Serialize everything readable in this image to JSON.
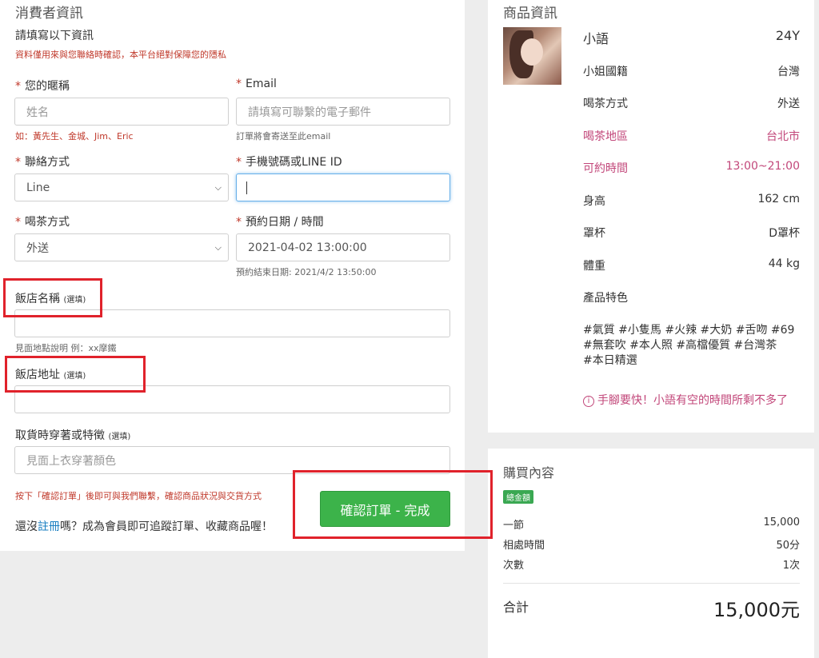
{
  "consumer": {
    "title": "消費者資訊",
    "subtitle": "請填寫以下資訊",
    "privacy_note": "資料僅用來與您聯絡時確認，本平台絕對保障您的隱私",
    "nickname_label": "您的暱稱",
    "nickname_placeholder": "姓名",
    "nickname_hint": "如：黃先生、金城、Jim、Eric",
    "email_label": "Email",
    "email_placeholder": "請填寫可聯繫的電子郵件",
    "email_hint": "訂單將會寄送至此email",
    "contact_label": "聯絡方式",
    "contact_value": "Line",
    "phone_label": "手機號碼或LINE ID",
    "phone_value": "",
    "tea_label": "喝茶方式",
    "tea_value": "外送",
    "datetime_label": "預約日期 / 時間",
    "datetime_value": "2021-04-02 13:00:00",
    "end_note": "預約結束日期: 2021/4/2 13:50:00",
    "hotel_name_label": "飯店名稱",
    "optional": "(選填)",
    "hotel_name_value": "",
    "meet_hint": "見面地點說明 例：xx摩鐵",
    "hotel_addr_label": "飯店地址",
    "hotel_addr_value": "",
    "pickup_label": "取貨時穿著或特徵",
    "pickup_placeholder": "見面上衣穿著顏色",
    "confirm_note": "按下「確認訂單」後即可與我們聯繫，確認商品狀況與交貨方式",
    "confirm_button": "確認訂單 - 完成",
    "register_prefix": "還沒",
    "register_link": "註冊",
    "register_suffix": "嗎？成為會員即可追蹤訂單、收藏商品喔！"
  },
  "product": {
    "title": "商品資訊",
    "name": "小語",
    "age": "24Y",
    "rows": [
      {
        "label": "小姐國籍",
        "value": "台灣"
      },
      {
        "label": "喝茶方式",
        "value": "外送"
      },
      {
        "label": "喝茶地區",
        "value": "台北市"
      },
      {
        "label": "可約時間",
        "value": "13:00~21:00"
      },
      {
        "label": "身高",
        "value": "162 cm"
      },
      {
        "label": "罩杯",
        "value": "D罩杯"
      },
      {
        "label": "體重",
        "value": "44 kg"
      },
      {
        "label": "產品特色",
        "value": ""
      }
    ],
    "tags_line1": "#氣質 #小隻馬 #火辣 #大奶 #舌吻 #69",
    "tags_line2": "#無套吹 #本人照 #高檔優質 #台灣茶",
    "tags_line3": "#本日精選",
    "warning": "手腳要快！小語有空的時間所剩不多了"
  },
  "purchase": {
    "title": "購買內容",
    "badge": "總金額",
    "lines": [
      {
        "label": "一節",
        "value": "15,000"
      },
      {
        "label": "相處時間",
        "value": "50分"
      },
      {
        "label": "次數",
        "value": "1次"
      }
    ],
    "total_label": "合計",
    "total_value": "15,000元"
  },
  "colors": {
    "accent_green": "#3cb34a",
    "highlight_pink": "#c2477a",
    "annotation_red": "#e0222b",
    "link_blue": "#1a7fc1"
  }
}
